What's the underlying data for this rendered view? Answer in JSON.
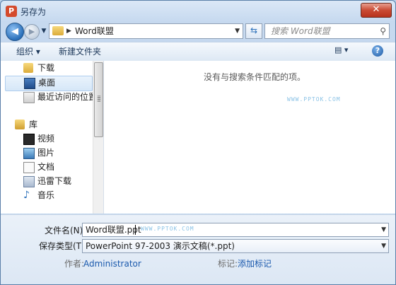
{
  "window": {
    "title": "另存为",
    "close_label": "✕"
  },
  "nav": {
    "address": "Word联盟",
    "search_placeholder": "搜索 Word联盟"
  },
  "toolbar": {
    "organize_label": "组织 ▾",
    "new_folder_label": "新建文件夹"
  },
  "sidebar": {
    "items": [
      {
        "label": "下载"
      },
      {
        "label": "桌面"
      },
      {
        "label": "最近访问的位置"
      },
      {
        "label": "库"
      },
      {
        "label": "视频"
      },
      {
        "label": "图片"
      },
      {
        "label": "文档"
      },
      {
        "label": "迅雷下载"
      },
      {
        "label": "音乐"
      }
    ]
  },
  "main": {
    "empty_message": "没有与搜索条件匹配的项。",
    "watermark": "WWW.PPTOK.COM"
  },
  "form": {
    "filename_label": "文件名(N):",
    "filename_value": "Word联盟.ppt",
    "filetype_label": "保存类型(T):",
    "filetype_value": "PowerPoint 97-2003 演示文稿(*.ppt)",
    "author_label": "作者:",
    "author_value": "Administrator",
    "tags_label": "标记:",
    "tags_value": "添加标记",
    "watermark": "WWW.PPTOK.COM"
  },
  "colors": {
    "accent": "#1a59ad",
    "selection": "#d6e7f8"
  }
}
